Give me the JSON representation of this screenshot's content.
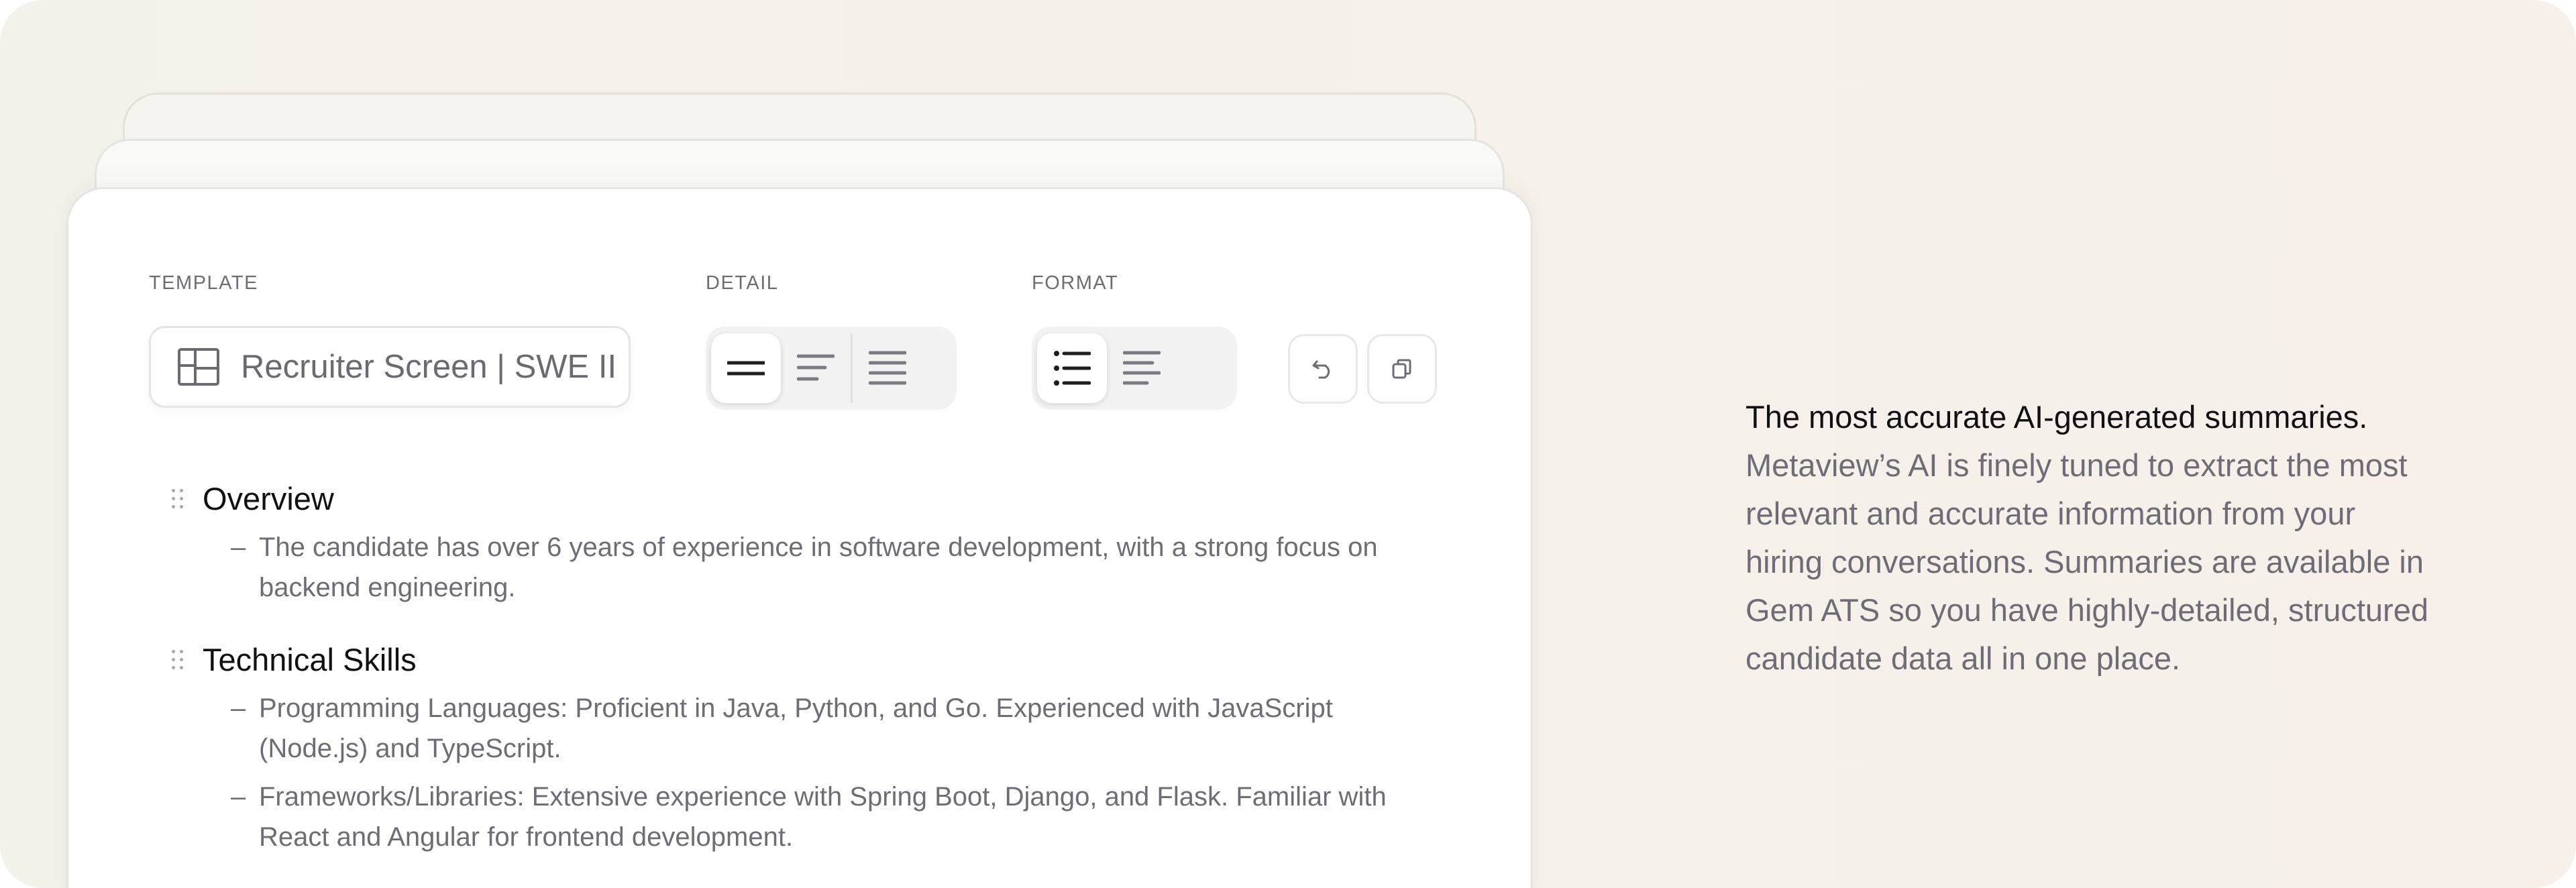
{
  "toolbar": {
    "template_label": "TEMPLATE",
    "template_value": "Recruiter Screen | SWE II",
    "template_icon": "layout-template-icon",
    "detail_label": "DETAIL",
    "detail_options": [
      "short-lines-icon",
      "medium-lines-icon",
      "long-lines-icon"
    ],
    "detail_selected": 0,
    "format_label": "FORMAT",
    "format_options": [
      "bulleted-list-icon",
      "paragraph-icon"
    ],
    "format_selected": 0,
    "undo_icon": "undo-icon",
    "copy_icon": "copy-icon"
  },
  "summary": {
    "sections": [
      {
        "title": "Overview",
        "bullets": [
          "The candidate has over 6 years of experience in software development, with a strong focus on backend engineering."
        ]
      },
      {
        "title": "Technical Skills",
        "bullets": [
          "Programming Languages: Proficient in Java, Python, and Go. Experienced with JavaScript (Node.js) and TypeScript.",
          "Frameworks/Libraries: Extensive experience with Spring Boot, Django, and Flask. Familiar with React and Angular for frontend development."
        ]
      }
    ],
    "bullet_marker": "–"
  },
  "marketing": {
    "lead": "The most accurate AI-generated summaries.",
    "body": "Metaview’s AI is finely tuned to extract the most relevant and accurate information from your hiring conversations. Summaries are available in Gem ATS so you have highly-detailed, structured candidate data all in one place."
  },
  "colors": {
    "background": "#f5f1ea",
    "heading_text": "#111114",
    "body_text": "#6e6d75"
  }
}
